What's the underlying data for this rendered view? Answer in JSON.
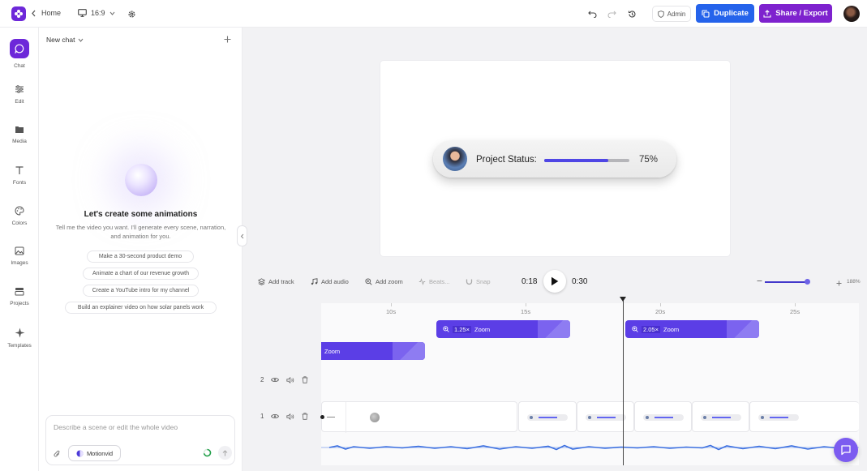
{
  "topbar": {
    "home_label": "Home",
    "aspect_ratio": "16:9",
    "admin_label": "Admin",
    "duplicate_label": "Duplicate",
    "share_label": "Share / Export"
  },
  "sidebar": {
    "items": [
      {
        "label": "Chat",
        "icon": "chat-bubble-icon",
        "active": true
      },
      {
        "label": "Edit",
        "icon": "sliders-icon",
        "active": false
      },
      {
        "label": "Media",
        "icon": "folder-icon",
        "active": false
      },
      {
        "label": "Fonts",
        "icon": "text-icon",
        "active": false
      },
      {
        "label": "Colors",
        "icon": "palette-icon",
        "active": false
      },
      {
        "label": "Images",
        "icon": "image-icon",
        "active": false
      },
      {
        "label": "Projects",
        "icon": "stack-icon",
        "active": false
      },
      {
        "label": "Templates",
        "icon": "sparkle-icon",
        "active": false
      }
    ]
  },
  "chat": {
    "new_chat_label": "New chat",
    "title": "Let's create some animations",
    "subtitle": "Tell me the video you want. I'll generate every scene, narration, and animation for you.",
    "suggestions": [
      "Make a 30-second product demo",
      "Animate a chart of our revenue growth",
      "Create a YouTube intro for my channel",
      "Build an explainer video on how solar panels work"
    ],
    "input_placeholder": "Describe a scene or edit the whole video",
    "model_label": "Motionvid"
  },
  "preview": {
    "status_label": "Project Status:",
    "progress_percent": 75,
    "progress_text": "75%"
  },
  "timeline": {
    "tools": {
      "add_track": "Add track",
      "add_audio": "Add audio",
      "add_zoom": "Add zoom",
      "beats": "Beats...",
      "snap": "Snap"
    },
    "current_time": "0:18",
    "total_time": "0:30",
    "zoom_level": "188%",
    "ruler": [
      "10s",
      "15s",
      "20s",
      "25s"
    ],
    "clips": [
      {
        "factor": "1.25×",
        "label": "Zoom"
      },
      {
        "factor": "2.05×",
        "label": "Zoom"
      },
      {
        "label": "Zoom"
      }
    ],
    "rows": [
      "2",
      "1"
    ]
  },
  "colors": {
    "brand": "#6d28d9",
    "duplicate": "#2563eb",
    "share": "#7e22ce",
    "clip": "#5b3ee6"
  }
}
